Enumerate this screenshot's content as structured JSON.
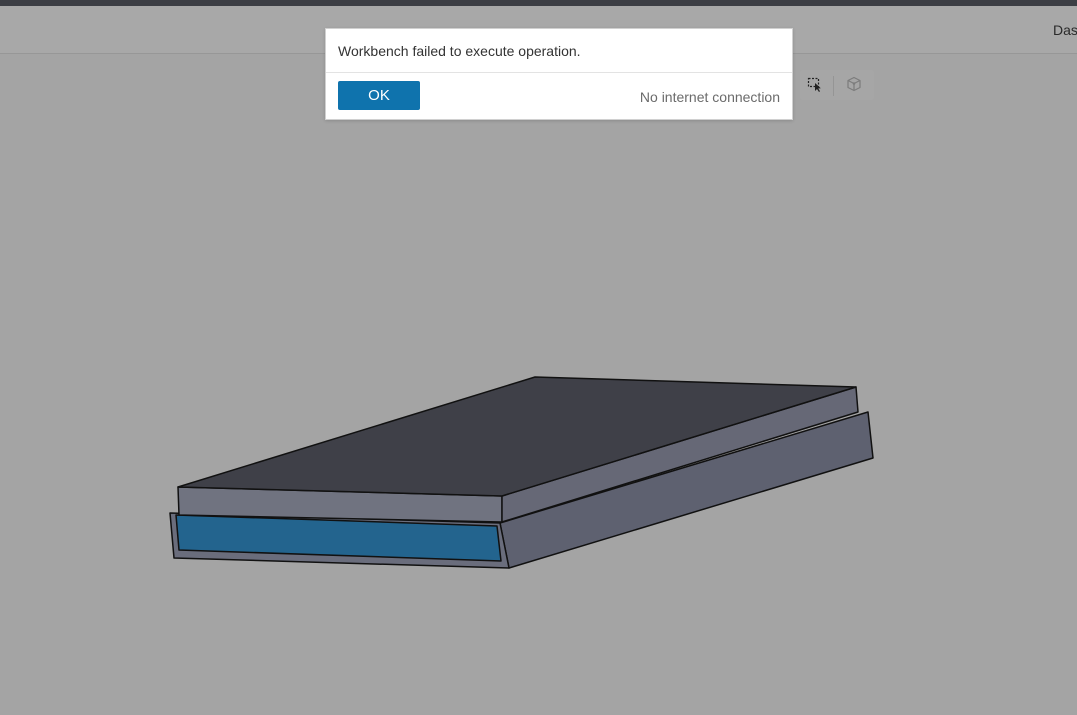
{
  "header": {
    "dashboard_label": "Das"
  },
  "toolbar": {
    "select_tool_icon": "box-select-cursor-icon",
    "cube_tool_icon": "cube-icon"
  },
  "dialog": {
    "message": "Workbench failed to execute operation.",
    "ok_label": "OK",
    "status": "No internet connection"
  },
  "colors": {
    "viewport_background": "#a4a4a4",
    "selected_face": "#23648e",
    "top_face": "#3f4048",
    "side_face": "#707380",
    "base_side": "#5e6170",
    "accent_button": "#0f73ad"
  }
}
